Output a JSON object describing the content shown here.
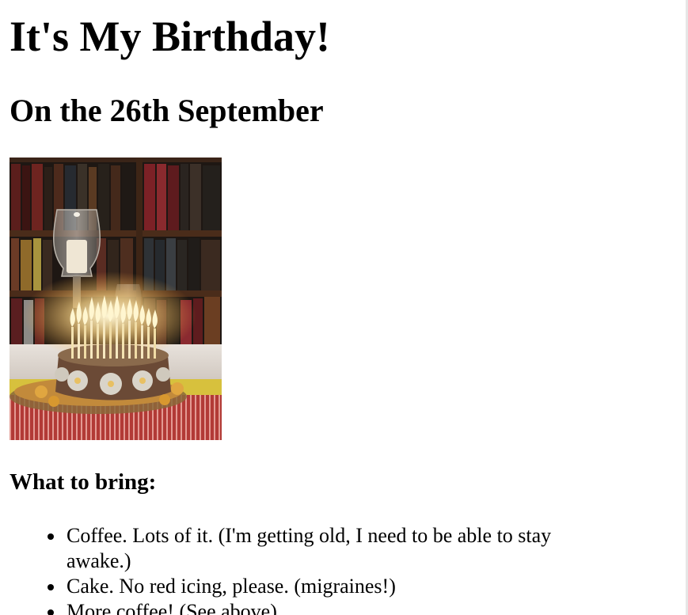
{
  "page": {
    "title": "It's My Birthday!",
    "date_heading": "On the 26th September",
    "image_alt": "Birthday cake with many lit candles",
    "bring_heading": "What to bring:",
    "bring_items": [
      "Coffee. Lots of it. (I'm getting old, I need to be able to stay awake.)",
      "Cake. No red icing, please. (migraines!)",
      "More coffee! (See above)"
    ]
  },
  "colors": {
    "text": "#000000",
    "background": "#ffffff"
  }
}
